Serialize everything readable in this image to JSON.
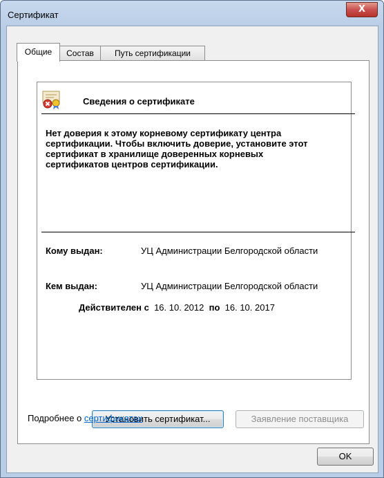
{
  "window": {
    "title": "Сертификат",
    "close_label": "X"
  },
  "tabs": [
    {
      "label": "Общие",
      "active": true
    },
    {
      "label": "Состав",
      "active": false
    },
    {
      "label": "Путь сертификации",
      "active": false
    }
  ],
  "info": {
    "heading": "Сведения о сертификате",
    "warning": "Нет доверия к этому корневому сертификату центра сертификации. Чтобы включить  доверие, установите этот сертификат в хранилище доверенных корневых сертификатов центров сертификации.",
    "issued_to_label": "Кому выдан:",
    "issued_to_value": "УЦ Администрации Белгородской области",
    "issued_by_label": "Кем выдан:",
    "issued_by_value": "УЦ Администрации Белгородской области",
    "valid_label": "Действителен с",
    "valid_from": "16. 10. 2012",
    "valid_to_label": "по",
    "valid_to": "16. 10. 2017"
  },
  "buttons": {
    "install": "Установить сертификат...",
    "issuer_statement": "Заявление поставщика",
    "ok": "OK"
  },
  "more_info": {
    "text": "Подробнее о ",
    "link": "сертификатах"
  },
  "icons": {
    "certificate": "certificate-icon",
    "error": "error-badge-icon",
    "close": "close-icon"
  }
}
